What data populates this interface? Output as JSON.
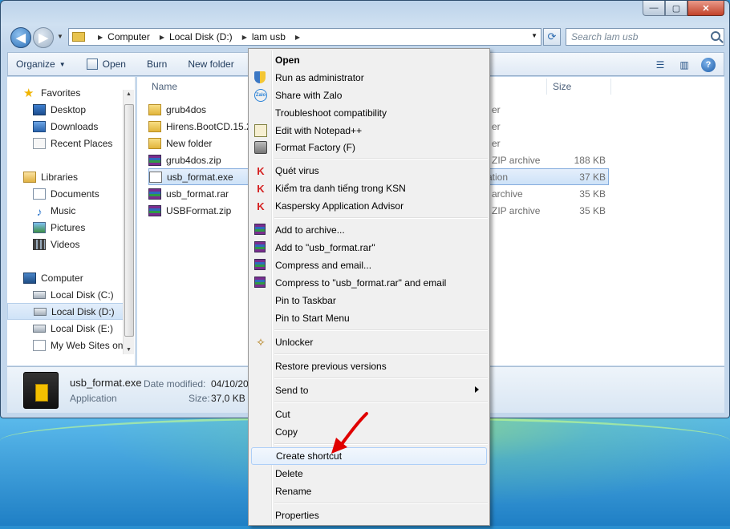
{
  "window": {
    "caption_min": "—",
    "caption_max": "▢",
    "caption_close": "✕"
  },
  "address": {
    "crumbs": [
      "Computer",
      "Local Disk (D:)",
      "lam usb"
    ],
    "search_placeholder": "Search lam usb"
  },
  "toolbar": {
    "organize": "Organize",
    "open": "Open",
    "burn": "Burn",
    "new_folder": "New folder"
  },
  "nav": {
    "favorites": "Favorites",
    "desktop": "Desktop",
    "downloads": "Downloads",
    "recent": "Recent Places",
    "libraries": "Libraries",
    "documents": "Documents",
    "music": "Music",
    "pictures": "Pictures",
    "videos": "Videos",
    "computer": "Computer",
    "drive_c": "Local Disk (C:)",
    "drive_d": "Local Disk (D:)",
    "drive_e": "Local Disk (E:)",
    "websites": "My Web Sites on"
  },
  "files": {
    "col_name": "Name",
    "col_size": "Size",
    "rows": [
      {
        "name": "grub4dos",
        "type_frag": "er",
        "size": ""
      },
      {
        "name": "Hirens.BootCD.15.2",
        "type_frag": "er",
        "size": ""
      },
      {
        "name": "New folder",
        "type_frag": "er",
        "size": ""
      },
      {
        "name": "grub4dos.zip",
        "type_frag": "ZIP archive",
        "size": "188 KB"
      },
      {
        "name": "usb_format.exe",
        "type_frag": "ation",
        "size": "37 KB"
      },
      {
        "name": "usb_format.rar",
        "type_frag": "archive",
        "size": "35 KB"
      },
      {
        "name": "USBFormat.zip",
        "type_frag": "ZIP archive",
        "size": "35 KB"
      }
    ]
  },
  "details": {
    "name": "usb_format.exe",
    "type": "Application",
    "modified_label": "Date modified:",
    "modified_value": "04/10/20",
    "size_label": "Size:",
    "size_value": "37,0 KB"
  },
  "menu": {
    "open": "Open",
    "run_admin": "Run as administrator",
    "share_zalo": "Share with Zalo",
    "troubleshoot": "Troubleshoot compatibility",
    "notepad": "Edit with Notepad++",
    "format_factory": "Format Factory (F)",
    "scan": "Quét virus",
    "ksn": "Kiểm tra danh tiếng trong KSN",
    "kaspersky": "Kaspersky Application Advisor",
    "add_archive": "Add to archive...",
    "add_rar": "Add to \"usb_format.rar\"",
    "compress_email": "Compress and email...",
    "compress_rar_email": "Compress to \"usb_format.rar\" and email",
    "pin_taskbar": "Pin to Taskbar",
    "pin_start": "Pin to Start Menu",
    "unlocker": "Unlocker",
    "restore": "Restore previous versions",
    "send_to": "Send to",
    "cut": "Cut",
    "copy": "Copy",
    "create_shortcut": "Create shortcut",
    "delete": "Delete",
    "rename": "Rename",
    "properties": "Properties"
  },
  "colors": {
    "accent": "#2b6fb6",
    "arrow": "#e00000"
  }
}
